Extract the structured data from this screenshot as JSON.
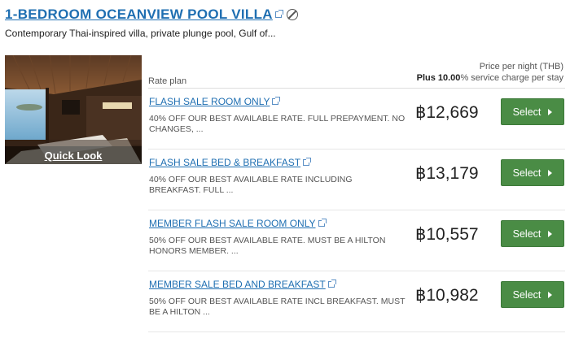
{
  "room": {
    "title": "1-BEDROOM OCEANVIEW POOL VILLA",
    "description": "Contemporary Thai-inspired villa, private plunge pool, Gulf of...",
    "photo_overlay": "Quick Look"
  },
  "rates_header": {
    "rate_plan_label": "Rate plan",
    "price_label": "Price per night (THB)",
    "service_strong": "Plus 10.00",
    "service_rest": "% service charge per stay"
  },
  "rates": [
    {
      "name": "FLASH SALE ROOM ONLY",
      "description": "40% OFF OUR BEST AVAILABLE RATE. FULL PREPAYMENT. NO CHANGES, ...",
      "price": "฿12,669",
      "button": "Select"
    },
    {
      "name": "FLASH SALE BED & BREAKFAST",
      "description": "40% OFF OUR BEST AVAILABLE RATE INCLUDING BREAKFAST. FULL ...",
      "price": "฿13,179",
      "button": "Select"
    },
    {
      "name": "MEMBER FLASH SALE ROOM ONLY",
      "description": "50% OFF OUR BEST AVAILABLE RATE. MUST BE A HILTON HONORS MEMBER. ...",
      "price": "฿10,557",
      "button": "Select"
    },
    {
      "name": "MEMBER SALE BED AND BREAKFAST",
      "description": "50% OFF OUR BEST AVAILABLE RATE INCL BREAKFAST. MUST BE A HILTON ...",
      "price": "฿10,982",
      "button": "Select"
    }
  ],
  "colors": {
    "link": "#1f6fb2",
    "select_button": "#4a8c45"
  },
  "icons": [
    "external-link-icon",
    "no-smoking-icon",
    "chevron-right-icon"
  ]
}
